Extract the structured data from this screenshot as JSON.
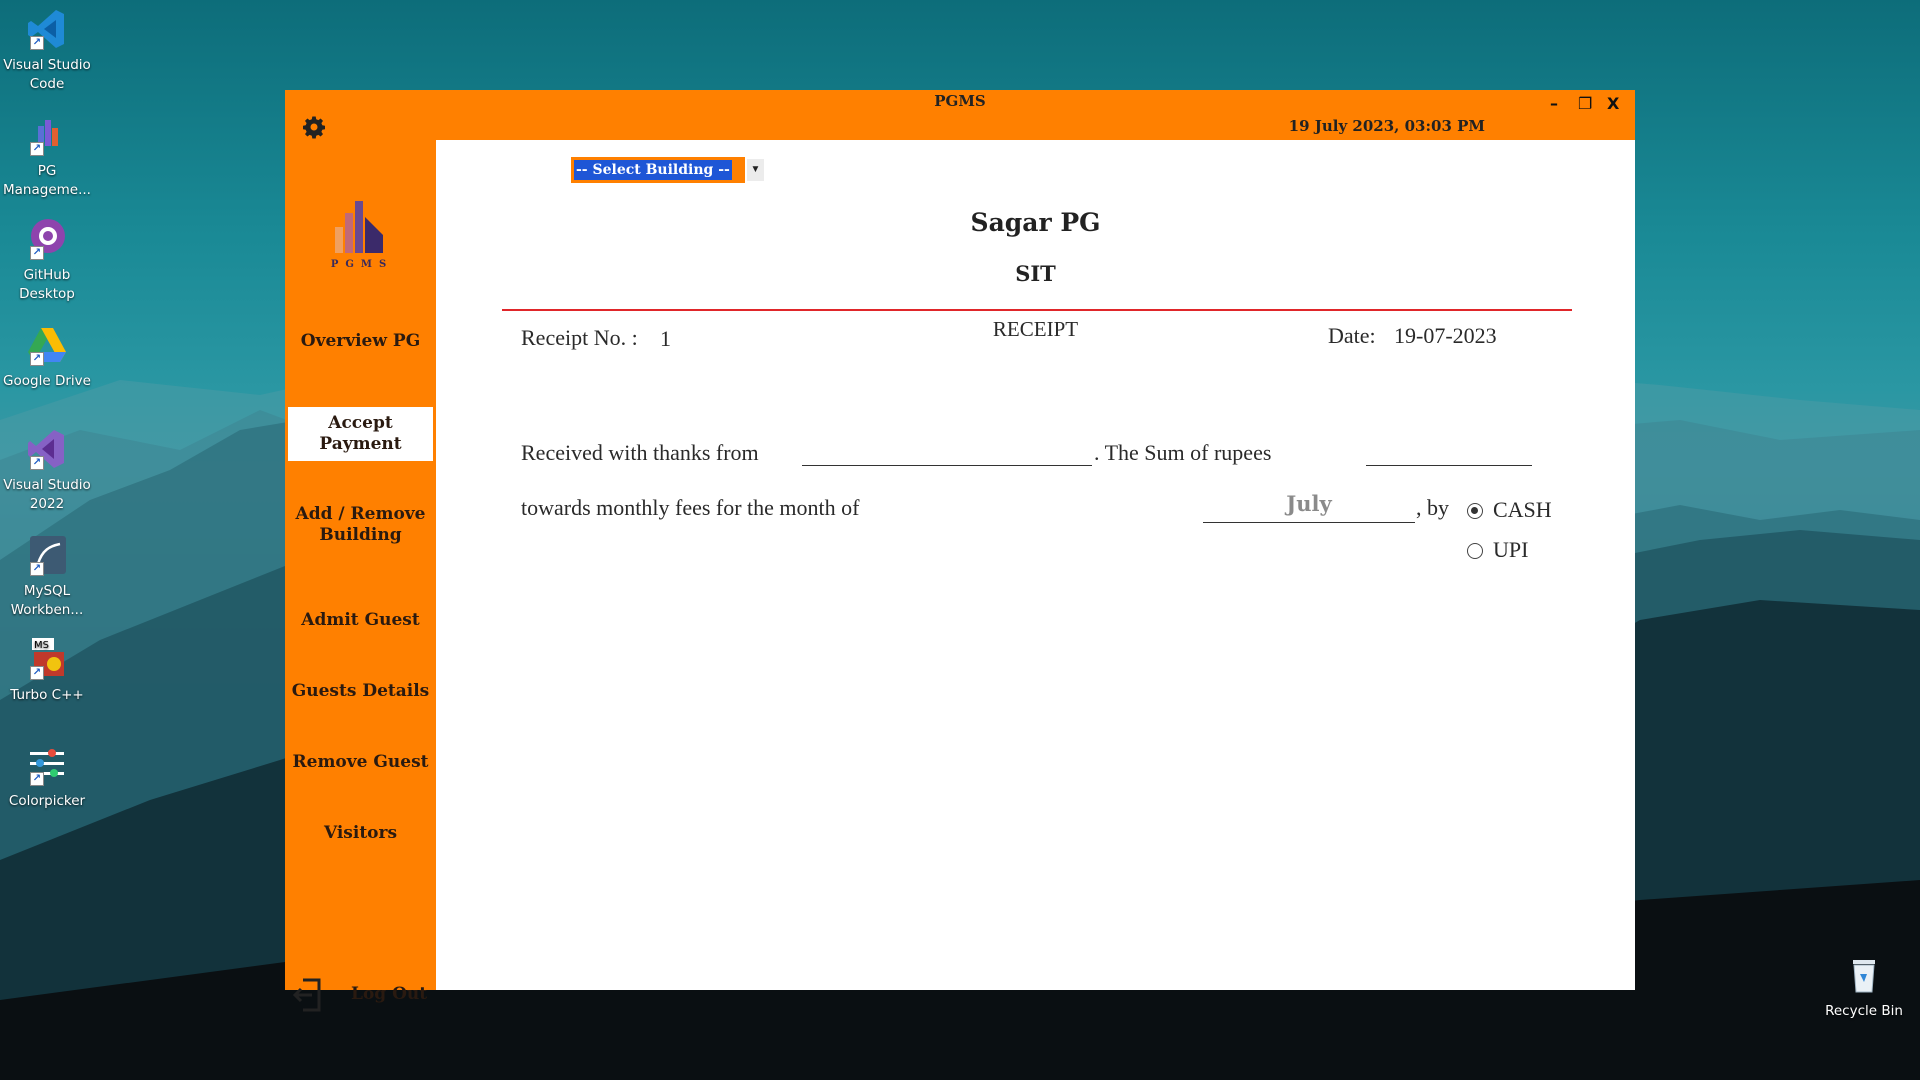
{
  "desktop": {
    "icons": [
      {
        "label": "Visual Studio Code",
        "icon": "vscode-icon"
      },
      {
        "label": "PG Manageme...",
        "icon": "pg-management-icon"
      },
      {
        "label": "GitHub Desktop",
        "icon": "github-desktop-icon"
      },
      {
        "label": "Google Drive",
        "icon": "google-drive-icon"
      },
      {
        "label": "Visual Studio 2022",
        "icon": "visual-studio-icon"
      },
      {
        "label": "MySQL Workben...",
        "icon": "mysql-workbench-icon"
      },
      {
        "label": "Turbo C++",
        "icon": "turbo-cpp-icon"
      },
      {
        "label": "Colorpicker",
        "icon": "colorpicker-icon"
      }
    ],
    "recycle_bin": {
      "label": "Recycle Bin",
      "icon": "recycle-bin-icon"
    }
  },
  "window": {
    "title": "PGMS",
    "datetime": "19 July 2023,  03:03 PM",
    "controls": {
      "minimize": "–",
      "maximize": "❐",
      "close": "X"
    },
    "accent_color": "#ff8000"
  },
  "sidebar": {
    "logo_text": "PGMS",
    "items": [
      {
        "label": "Overview PG"
      },
      {
        "label": "Accept Payment",
        "active": true
      },
      {
        "label": "Add / Remove Building"
      },
      {
        "label": "Admit Guest"
      },
      {
        "label": "Guests Details"
      },
      {
        "label": "Remove Guest"
      },
      {
        "label": "Visitors"
      }
    ],
    "logout_label": "Log Out"
  },
  "content": {
    "building_select": {
      "selected": "-- Select Building --"
    },
    "org_name": "Sagar PG",
    "org_sub": "SIT",
    "receipt_no_label": "Receipt No. :",
    "receipt_no_value": "1",
    "receipt_title": "RECEIPT",
    "date_label": "Date:",
    "date_value": "19-07-2023",
    "received_text": "Received with thanks from",
    "sum_text": ". The Sum of rupees",
    "towards_text": "towards monthly fees for the month of",
    "month_value": "July",
    "by_text": ", by",
    "payment_options": [
      {
        "label": "CASH",
        "checked": true
      },
      {
        "label": "UPI",
        "checked": false
      }
    ],
    "rule_color": "#e0262a"
  }
}
